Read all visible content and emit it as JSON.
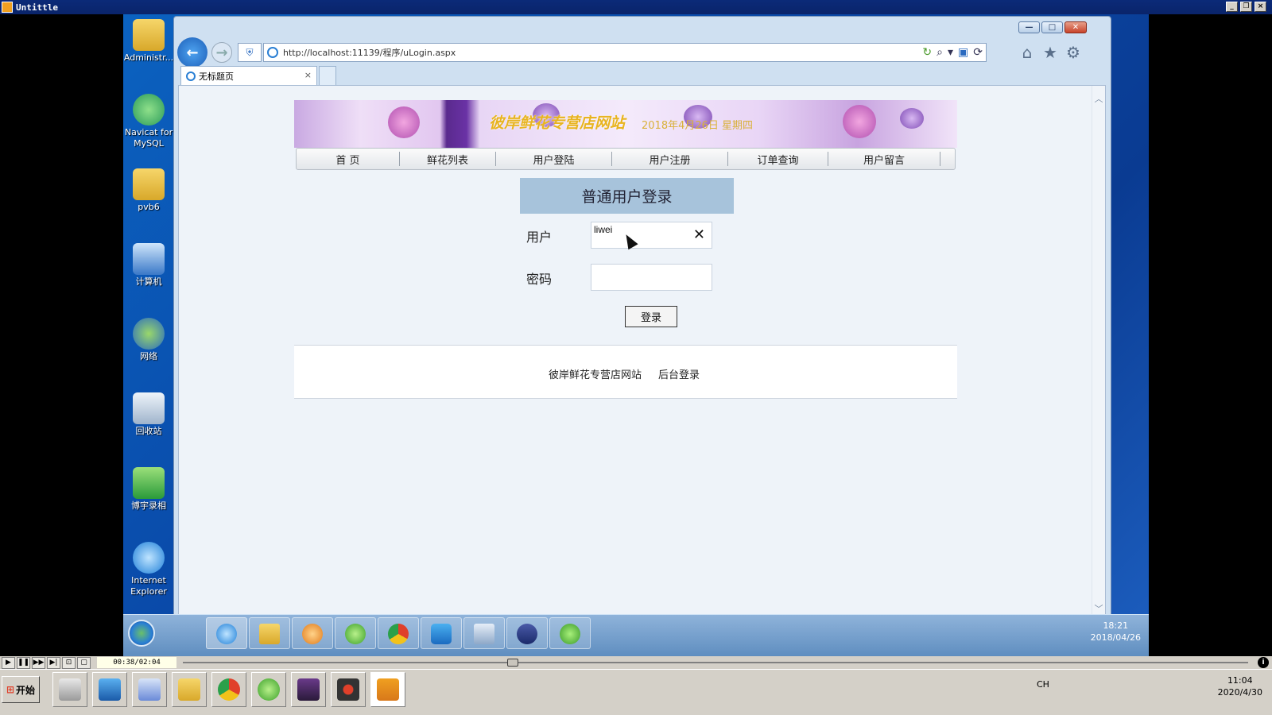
{
  "player_window": {
    "title": "Untittle"
  },
  "desktop_icons": [
    {
      "name": "folder",
      "label": "Administr..."
    },
    {
      "name": "navicat",
      "label": "Navicat for MySQL"
    },
    {
      "name": "folder",
      "label": "pvb6"
    },
    {
      "name": "computer",
      "label": "计算机"
    },
    {
      "name": "network",
      "label": "网络"
    },
    {
      "name": "recycle-bin",
      "label": "回收站"
    },
    {
      "name": "recorder",
      "label": "博宇录相"
    },
    {
      "name": "internet-explorer",
      "label": "Internet Explorer"
    }
  ],
  "browser": {
    "url": "http://localhost:11139/程序/uLogin.aspx",
    "tab_title": "无标题页"
  },
  "page": {
    "banner_title": "彼岸鲜花专营店网站",
    "banner_date": "2018年4月26日  星期四",
    "nav": [
      "首  页",
      "鲜花列表",
      "用户登陆",
      "用户注册",
      "订单查询",
      "用户留言"
    ],
    "login": {
      "heading": "普通用户登录",
      "user_label": "用户",
      "user_value": "liwei",
      "password_label": "密码",
      "password_value": "",
      "submit_label": "登录"
    },
    "footer": {
      "site_name": "彼岸鲜花专营店网站",
      "admin_link": "后台登录"
    }
  },
  "vm_taskbar": {
    "time": "18:21",
    "date": "2018/04/26"
  },
  "player": {
    "time": "00:38/02:04",
    "progress": 0.31
  },
  "host_taskbar": {
    "start_label": "开始",
    "lang": "CH",
    "time": "11:04",
    "date": "2020/4/30"
  },
  "colors": {
    "login_header_bg": "#a7c3db",
    "banner_title": "#e8b420",
    "vm_desktop": "#0a49a8"
  }
}
